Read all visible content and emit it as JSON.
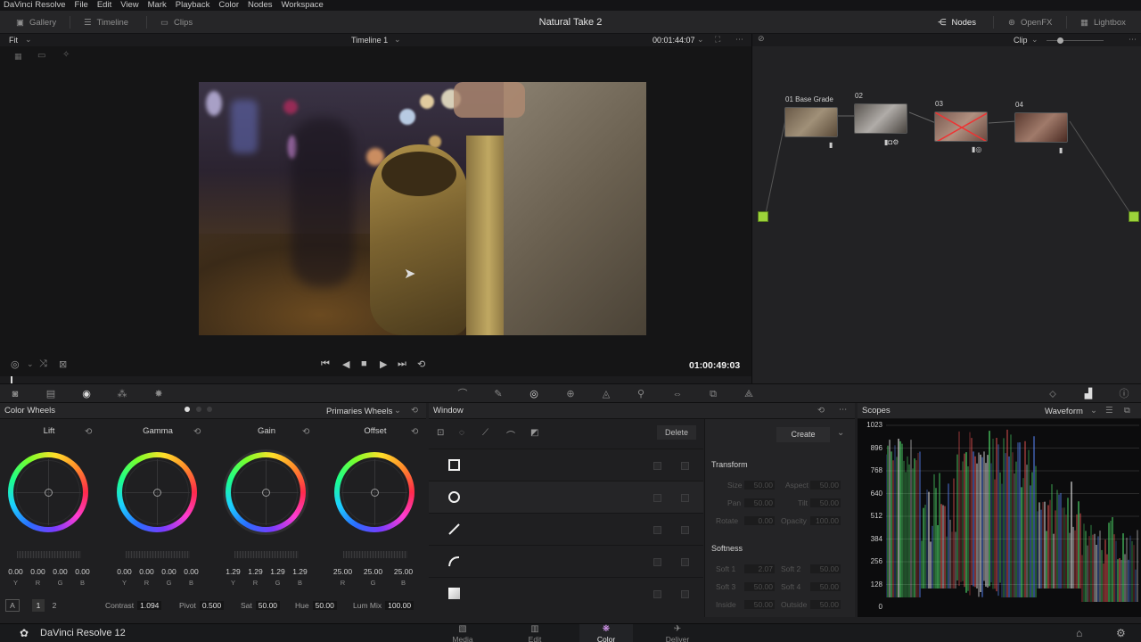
{
  "menubar": {
    "items": [
      "DaVinci Resolve",
      "File",
      "Edit",
      "View",
      "Mark",
      "Playback",
      "Color",
      "Nodes",
      "Workspace"
    ]
  },
  "toolbar": {
    "gallery": "Gallery",
    "timeline": "Timeline",
    "clips": "Clips",
    "project_title": "Natural Take 2",
    "nodes": "Nodes",
    "openfx": "OpenFX",
    "lightbox": "Lightbox"
  },
  "viewer": {
    "zoom": "Fit",
    "timeline_name": "Timeline 1",
    "source_timecode": "00:01:44:07",
    "record_timecode": "01:00:49:03",
    "node_mode": "Clip"
  },
  "nodes": [
    {
      "label": "01 Base Grade"
    },
    {
      "label": "02"
    },
    {
      "label": "03"
    },
    {
      "label": "04"
    }
  ],
  "color_wheels": {
    "title": "Color Wheels",
    "mode": "Primaries Wheels",
    "wheels": [
      {
        "name": "Lift",
        "values": [
          "0.00",
          "0.00",
          "0.00",
          "0.00"
        ],
        "channels": [
          "Y",
          "R",
          "G",
          "B"
        ]
      },
      {
        "name": "Gamma",
        "values": [
          "0.00",
          "0.00",
          "0.00",
          "0.00"
        ],
        "channels": [
          "Y",
          "R",
          "G",
          "B"
        ]
      },
      {
        "name": "Gain",
        "values": [
          "1.29",
          "1.29",
          "1.29",
          "1.29"
        ],
        "channels": [
          "Y",
          "R",
          "G",
          "B"
        ]
      },
      {
        "name": "Offset",
        "values": [
          "25.00",
          "25.00",
          "25.00"
        ],
        "channels": [
          "R",
          "G",
          "B"
        ]
      }
    ],
    "footer": {
      "a_label": "A",
      "page1": "1",
      "page2": "2",
      "contrast_label": "Contrast",
      "contrast": "1.094",
      "pivot_label": "Pivot",
      "pivot": "0.500",
      "sat_label": "Sat",
      "sat": "50.00",
      "hue_label": "Hue",
      "hue": "50.00",
      "lummix_label": "Lum Mix",
      "lummix": "100.00"
    }
  },
  "window": {
    "title": "Window",
    "delete_label": "Delete",
    "create_label": "Create",
    "transform_label": "Transform",
    "softness_label": "Softness",
    "transform": [
      {
        "label": "Size",
        "value": "50.00"
      },
      {
        "label": "Aspect",
        "value": "50.00"
      },
      {
        "label": "Pan",
        "value": "50.00"
      },
      {
        "label": "Tilt",
        "value": "50.00"
      },
      {
        "label": "Rotate",
        "value": "0.00"
      },
      {
        "label": "Opacity",
        "value": "100.00"
      }
    ],
    "softness": [
      {
        "label": "Soft 1",
        "value": "2.07"
      },
      {
        "label": "Soft 2",
        "value": "50.00"
      },
      {
        "label": "Soft 3",
        "value": "50.00"
      },
      {
        "label": "Soft 4",
        "value": "50.00"
      },
      {
        "label": "Inside",
        "value": "50.00"
      },
      {
        "label": "Outside",
        "value": "50.00"
      }
    ]
  },
  "scopes": {
    "title": "Scopes",
    "mode": "Waveform",
    "scale": [
      "1023",
      "896",
      "768",
      "640",
      "512",
      "384",
      "256",
      "128",
      "0"
    ]
  },
  "bottombar": {
    "app_name": "DaVinci Resolve 12",
    "pages": [
      "Media",
      "Edit",
      "Color",
      "Deliver"
    ],
    "active_page": "Color"
  }
}
